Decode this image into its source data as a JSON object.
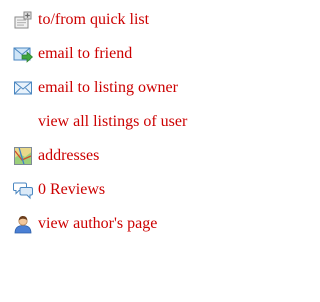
{
  "actions": [
    {
      "label": "to/from quick list",
      "icon": "quick-list-icon"
    },
    {
      "label": "email to friend",
      "icon": "email-forward-icon"
    },
    {
      "label": "email to listing owner",
      "icon": "envelope-icon"
    },
    {
      "label": "view all listings of user",
      "icon": ""
    },
    {
      "label": "addresses",
      "icon": "map-icon"
    },
    {
      "label": "0 Reviews",
      "icon": "speech-bubbles-icon"
    },
    {
      "label": "view author's page",
      "icon": "user-icon"
    }
  ],
  "colors": {
    "link": "#cc0000",
    "background": "#ffffff"
  }
}
